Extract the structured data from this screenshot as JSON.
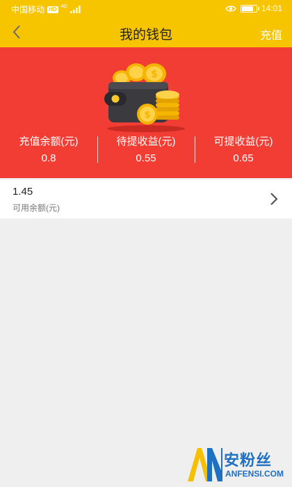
{
  "status_bar": {
    "carrier": "中国移动",
    "network_badge": "HD",
    "signal_label": "4G",
    "time": "14:01",
    "battery_level": 0.85
  },
  "nav": {
    "back_icon": "chevron-left-icon",
    "title": "我的钱包",
    "action_label": "充值"
  },
  "wallet": {
    "illustration": "wallet-with-coins",
    "stats": [
      {
        "label": "充值余额(元)",
        "value": "0.8"
      },
      {
        "label": "待提收益(元)",
        "value": "0.55"
      },
      {
        "label": "可提收益(元)",
        "value": "0.65"
      }
    ]
  },
  "balance": {
    "value": "1.45",
    "label": "可用余额(元)"
  },
  "watermark": {
    "logo": "AN",
    "text_cn": "安粉丝",
    "text_en": "ANFENSI.COM"
  },
  "colors": {
    "header_yellow": "#f7c400",
    "panel_red": "#f13d33",
    "background": "#efefef",
    "watermark_blue": "#1f6fc2"
  }
}
